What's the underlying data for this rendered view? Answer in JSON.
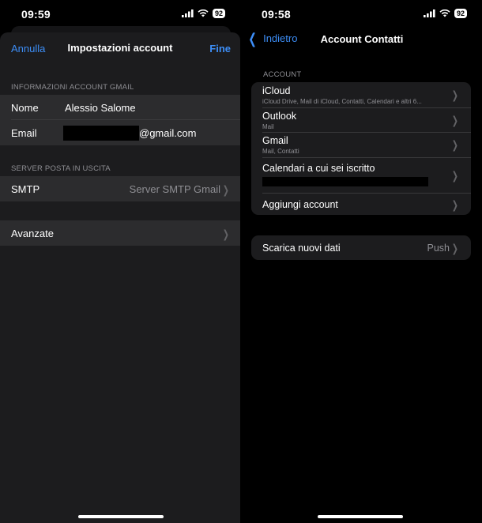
{
  "left": {
    "status": {
      "time": "09:59",
      "battery": "92"
    },
    "nav": {
      "cancel": "Annulla",
      "title": "Impostazioni account",
      "done": "Fine"
    },
    "gmail_section": {
      "header": "INFORMAZIONI ACCOUNT GMAIL",
      "name_label": "Nome",
      "name_value": "Alessio Salome",
      "email_label": "Email",
      "email_suffix": "@gmail.com"
    },
    "smtp_section": {
      "header": "SERVER POSTA IN USCITA",
      "smtp_label": "SMTP",
      "smtp_value": "Server SMTP Gmail"
    },
    "advanced_label": "Avanzate"
  },
  "right": {
    "status": {
      "time": "09:58",
      "battery": "92"
    },
    "nav": {
      "back": "Indietro",
      "title": "Account Contatti"
    },
    "accounts_header": "ACCOUNT",
    "accounts": [
      {
        "title": "iCloud",
        "subtitle": "iCloud Drive, Mail di iCloud, Contatti, Calendari e altri 6..."
      },
      {
        "title": "Outlook",
        "subtitle": "Mail"
      },
      {
        "title": "Gmail",
        "subtitle": "Mail, Contatti"
      },
      {
        "title": "Calendari a cui sei iscritto"
      },
      {
        "title": "Aggiungi account"
      }
    ],
    "fetch": {
      "label": "Scarica nuovi dati",
      "value": "Push"
    }
  },
  "icons": [
    "cellular-signal-icon",
    "wifi-icon",
    "battery-icon",
    "chevron-right-icon",
    "chevron-left-icon"
  ],
  "colors": {
    "accent": "#3d8ef7",
    "background": "#000000",
    "grouped": "#1c1c1e",
    "row": "#2c2c2e",
    "secondary_text": "#8e8e93"
  }
}
